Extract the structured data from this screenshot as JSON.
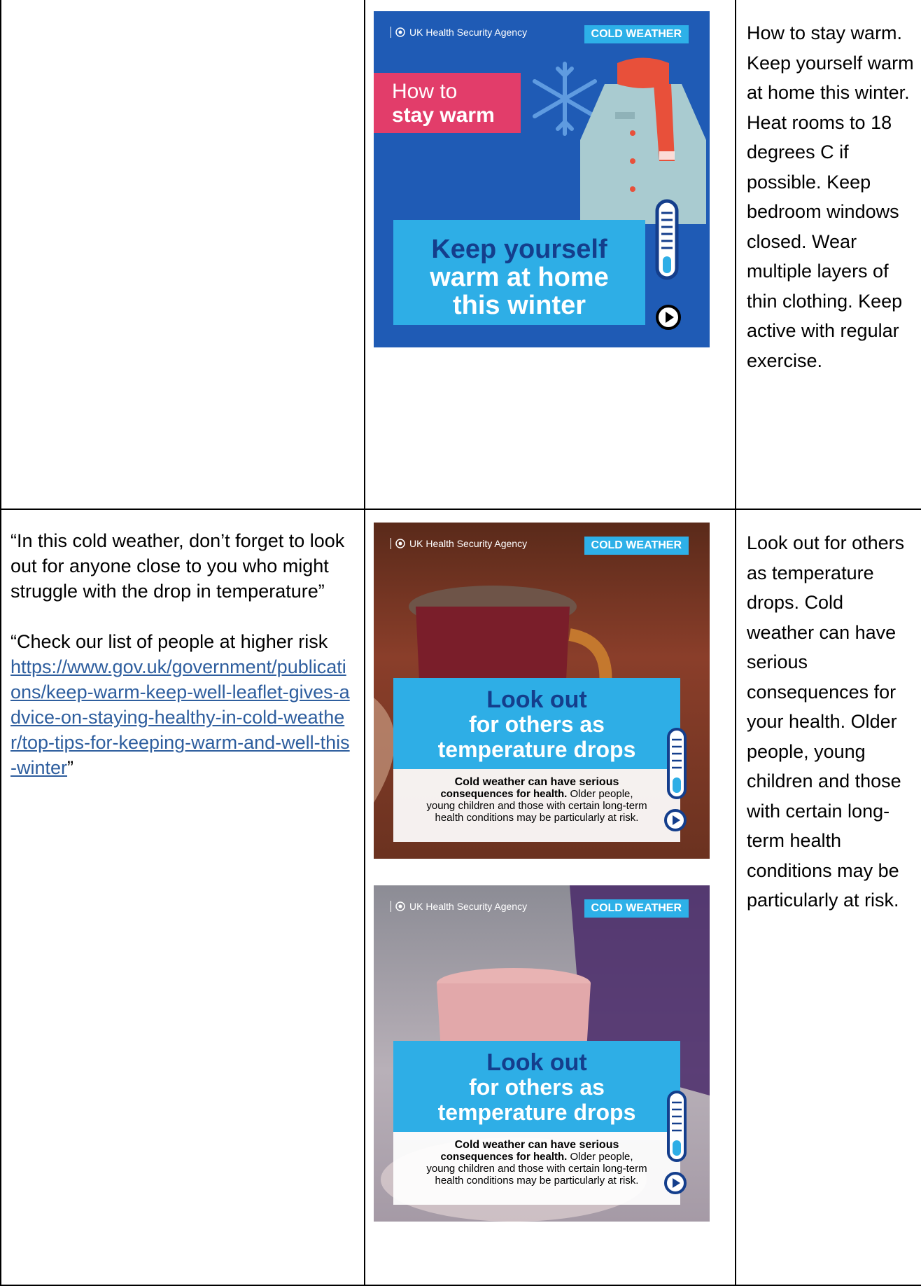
{
  "row1": {
    "poster": {
      "agency": "UK Health Security Agency",
      "badge": "COLD WEATHER",
      "label_line1": "How to",
      "label_line2": "stay warm",
      "main_line1": "Keep yourself",
      "main_line2": "warm at home",
      "main_line3": "this winter"
    },
    "description": "How to stay warm. Keep yourself warm at home this winter. Heat rooms to 18 degrees C if possible. Keep bedroom windows closed. Wear multiple layers of thin clothing. Keep active with regular exercise."
  },
  "row2": {
    "quote1": "“In this cold weather, don’t forget to look out for anyone close to you who might struggle with the drop in temperature”",
    "quote2_prefix": "“Check our list of people at higher risk",
    "quote2_link": "https://www.gov.uk/government/publications/keep-warm-keep-well-leaflet-gives-advice-on-staying-healthy-in-cold-weather/top-tips-for-keeping-warm-and-well-this-winter",
    "quote2_suffix": "”",
    "poster": {
      "agency": "UK Health Security Agency",
      "badge": "COLD WEATHER",
      "title_line1": "Look out",
      "title_line2": "for others as",
      "title_line3": "temperature drops",
      "body_line1": "Cold weather can have serious",
      "body_line2_bold": "consequences for health.",
      "body_line2_rest": " Older people,",
      "body_line3": "young children and those with certain long-term",
      "body_line4": "health conditions may be particularly at risk."
    },
    "description": "Look out for others as temperature drops. Cold weather can have serious consequences for your health. Older people, young children and those with certain long-term health conditions may be particularly at risk."
  },
  "colors": {
    "poster1_bg": "#1f5bb5",
    "pink": "#e23d6a",
    "light_blue": "#2eaee6",
    "dark_blue_text": "#143e8c",
    "link": "#2e5e9e"
  }
}
